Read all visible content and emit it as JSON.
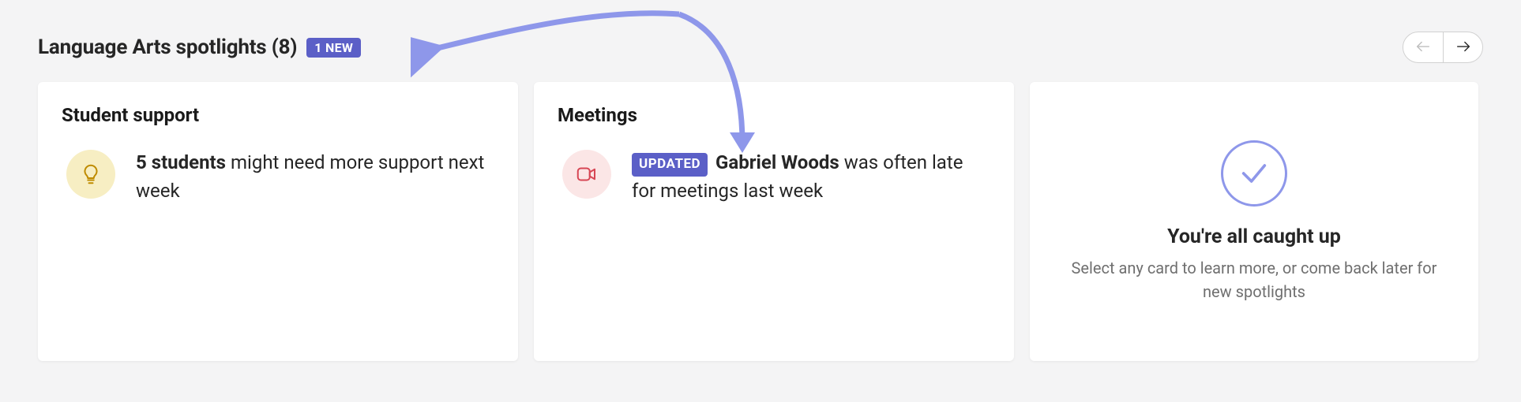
{
  "header": {
    "title": "Language Arts spotlights (8)",
    "new_badge": "1 NEW"
  },
  "cards": {
    "support": {
      "title": "Student support",
      "count": "5 students",
      "suffix": " might need more support next week",
      "icon": "lightbulb-icon"
    },
    "meetings": {
      "title": "Meetings",
      "updated_badge": "UPDATED",
      "name": "Gabriel Woods",
      "suffix": " was often late for meetings last week",
      "icon": "video-camera-icon"
    },
    "caught_up": {
      "title": "You're all caught up",
      "subtitle": "Select any card to learn more, or come back later for new spotlights",
      "icon": "checkmark-icon"
    }
  },
  "colors": {
    "accent": "#5B5FC7",
    "icon_accent": "#8e97ea",
    "bulb": "#bf8b00",
    "camera": "#d74654"
  }
}
